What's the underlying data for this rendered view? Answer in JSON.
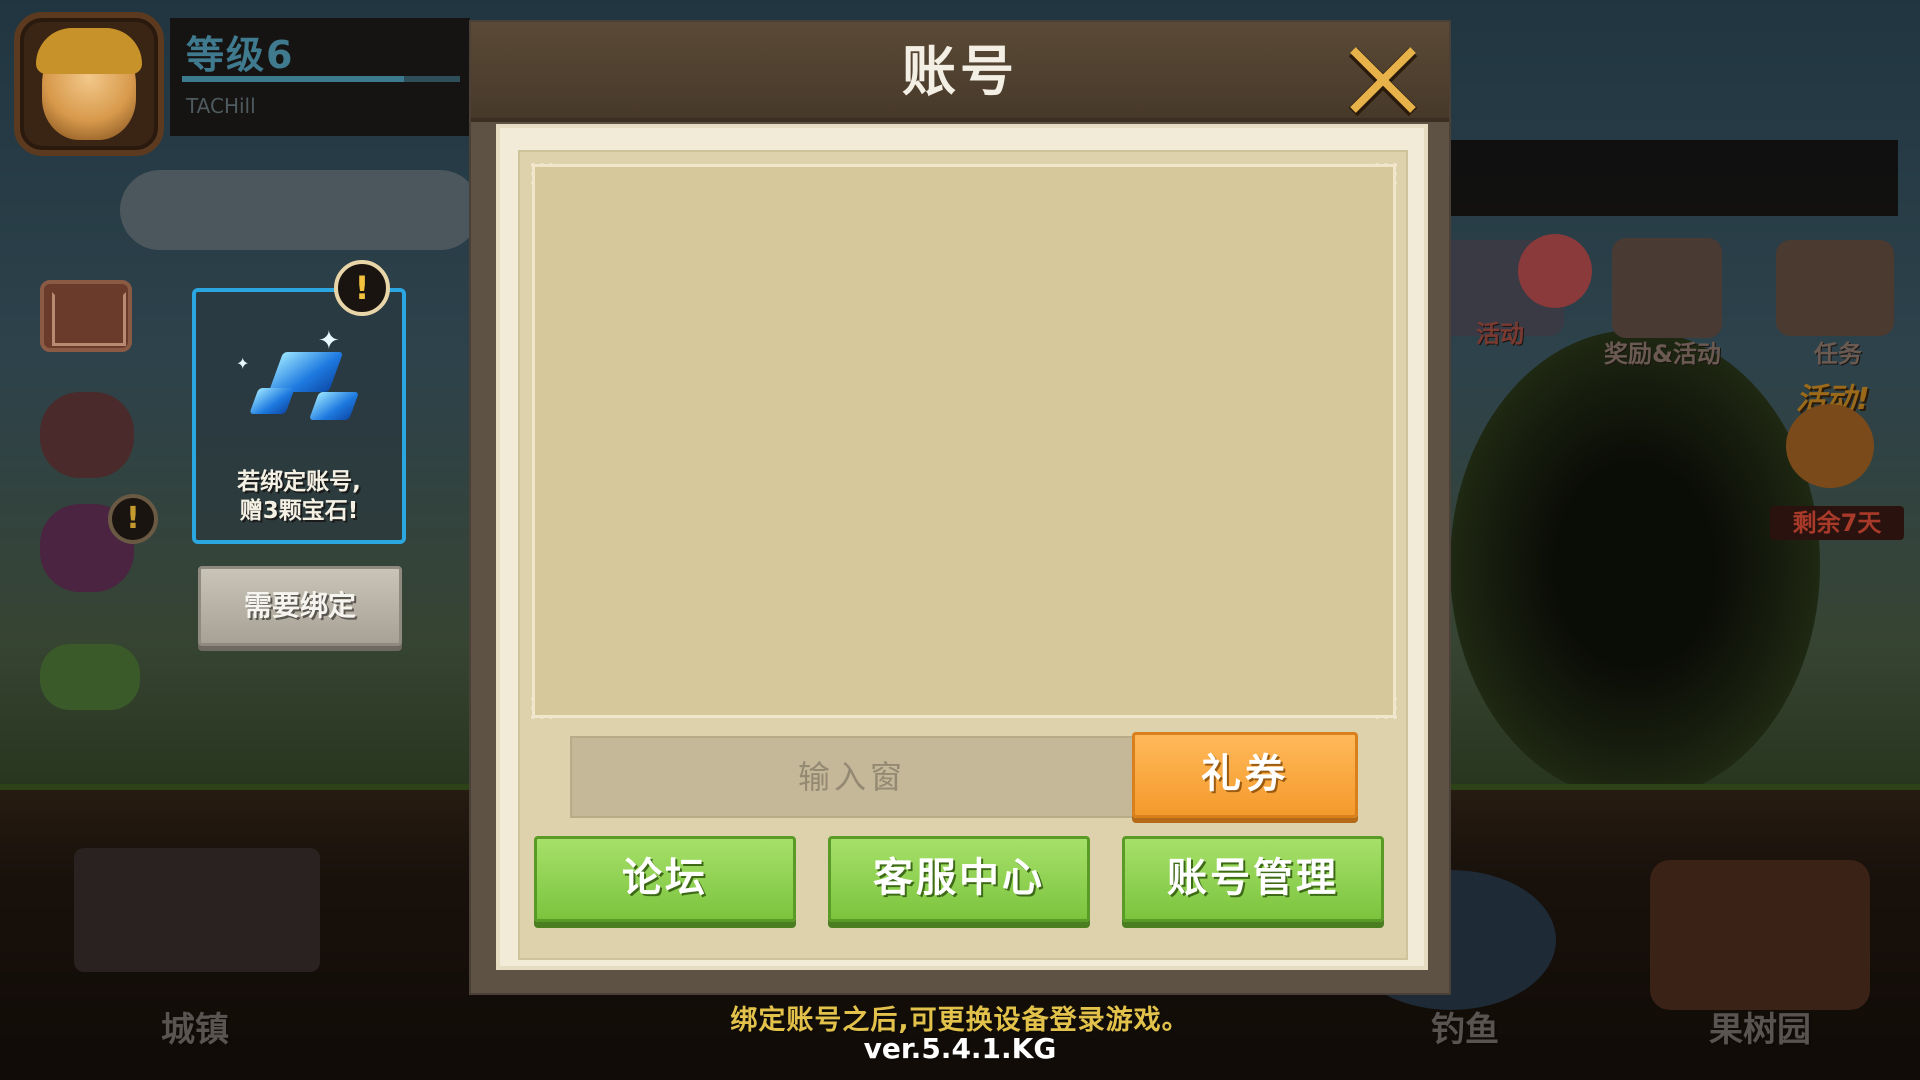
{
  "profile": {
    "level": "等级6",
    "name": "TACHill",
    "exp_fraction": 0.8
  },
  "bind_card": {
    "text_line1": "若绑定账号,",
    "text_line2": "赠3颗宝石!",
    "alert": "!",
    "button_label": "需要绑定"
  },
  "side": {
    "alert": "!"
  },
  "events": {
    "event1": "活动",
    "event2": "奖励&活动",
    "event3": "任务",
    "activity_tag": "活动!",
    "remaining": "剩余7天"
  },
  "bottom_nav": {
    "town": "城镇",
    "fishing": "钓鱼",
    "orchard": "果树园"
  },
  "modal": {
    "title": "账号",
    "input_placeholder": "输入窗",
    "coupon_button": "礼券",
    "forum_button": "论坛",
    "support_button": "客服中心",
    "manage_button": "账号管理"
  },
  "footer": {
    "hint": "绑定账号之后,可更换设备登录游戏。",
    "version": "ver.5.4.1.KG"
  },
  "colors": {
    "modal_header": "#5a4a36",
    "panel": "#d6c89a",
    "coupon": "#f49a2c",
    "green_button": "#7cc43e",
    "hint": "#e2c24a"
  }
}
